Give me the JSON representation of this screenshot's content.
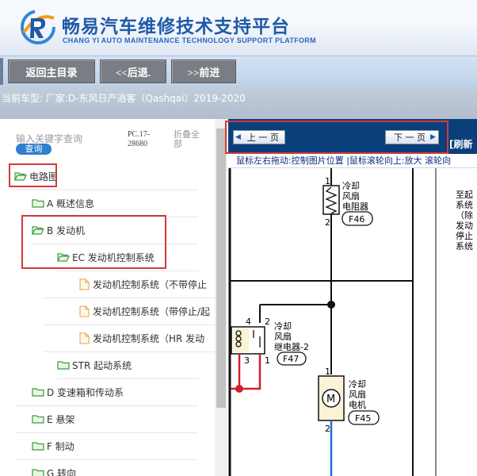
{
  "brand": {
    "name_cn": "畅易汽车维修技术支持平台",
    "name_en": "CHANG YI AUTO MAINTENANCE TECHNOLOGY SUPPORT PLATFORM"
  },
  "nav": {
    "home_label": "返回主目录",
    "back_label": "<<后退.",
    "forward_label": ">>前进"
  },
  "model": {
    "text": "当前车型:  厂家:D-东风日产逍客（Qashqai）2019-2020"
  },
  "search": {
    "placeholder": "输入关键字查询",
    "button_label": "查询",
    "pc_code": "PC.17-28680",
    "collapse_all": "折叠全部"
  },
  "tree": {
    "root": "电路图",
    "a": "A 概述信息",
    "b": "B 发动机",
    "ec": "EC 发动机控制系统",
    "doc1": "发动机控制系统（不带停止",
    "doc2": "发动机控制系统（带停止/起",
    "doc3": "发动机控制系统（HR 发动",
    "str": "STR 起动系统",
    "d": "D 变速箱和传动系",
    "e": "E 悬架",
    "f": "F 制动",
    "g": "G 转向"
  },
  "viewer": {
    "prev_label": "上 一 页",
    "next_label": "下 一 页",
    "refresh_label": "[刷新",
    "hint": "鼠标左右拖动:控制图片位置 |鼠标滚轮向上:放大  滚轮向"
  },
  "diagram": {
    "pin1": "1",
    "pin2": "2",
    "resistor_label_1": "冷却",
    "resistor_label_2": "风扇",
    "resistor_label_3": "电阻器",
    "resistor_code": "F46",
    "relay_pin4": "4",
    "relay_pin2": "2",
    "relay_pin3": "3",
    "relay_pin1": "1",
    "relay_label_1": "冷却",
    "relay_label_2": "风扇",
    "relay_label_3": "继电器-2",
    "relay_code": "F47",
    "motor_pin1": "1",
    "motor_pin2": "2",
    "motor_symbol": "M",
    "motor_label_1": "冷却",
    "motor_label_2": "风扇",
    "motor_label_3": "电机",
    "motor_code": "F45",
    "note_1": "至起",
    "note_2": "系统",
    "note_3": "（除",
    "note_4": "发动",
    "note_5": "停止",
    "note_6": "系统"
  },
  "colors": {
    "brand_blue": "#1f5aa8",
    "highlight_red": "#d33a3a",
    "header_navy": "#0b3f7c",
    "wire_red": "#d0202a",
    "wire_blue": "#1f6fd0"
  }
}
